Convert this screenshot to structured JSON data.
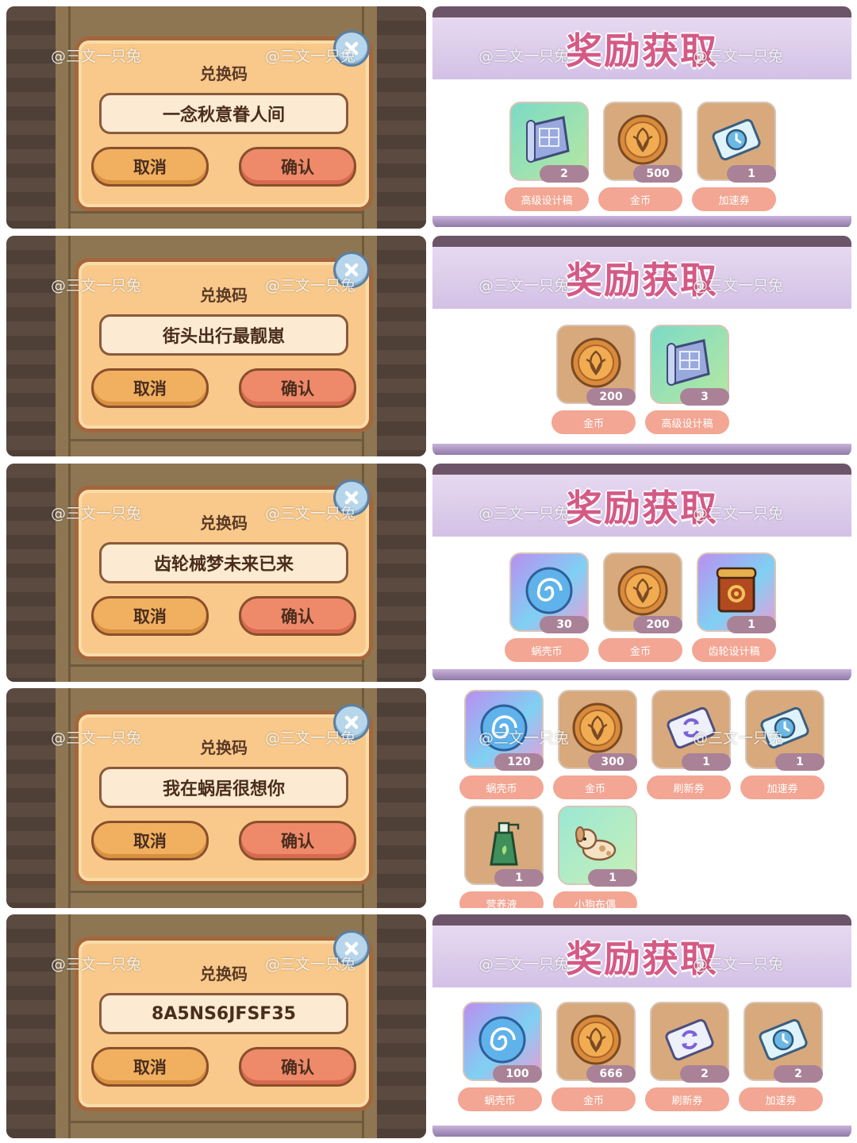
{
  "watermark": "@三文一只兔",
  "dialog": {
    "title": "兑换码",
    "cancel_label": "取消",
    "confirm_label": "确认"
  },
  "reward_header": "奖励获取",
  "codes": [
    "一念秋意眷人间",
    "街头出行最靓崽",
    "齿轮械梦未来已来",
    "我在蜗居很想你",
    "8A5NS6JFSF35"
  ],
  "rewards": [
    [
      {
        "icon": "blueprint-scroll-icon",
        "qty": "2",
        "label": "高级设计稿"
      },
      {
        "icon": "gold-coin-icon",
        "qty": "500",
        "label": "金币"
      },
      {
        "icon": "speedup-ticket-icon",
        "qty": "1",
        "label": "加速券"
      }
    ],
    [
      {
        "icon": "gold-coin-icon",
        "qty": "200",
        "label": "金币"
      },
      {
        "icon": "blueprint-scroll-icon",
        "qty": "3",
        "label": "高级设计稿"
      }
    ],
    [
      {
        "icon": "snail-shell-coin-icon",
        "qty": "30",
        "label": "蜗壳币"
      },
      {
        "icon": "gold-coin-icon",
        "qty": "200",
        "label": "金币"
      },
      {
        "icon": "gear-blueprint-icon",
        "qty": "1",
        "label": "齿轮设计稿"
      }
    ],
    [
      {
        "icon": "snail-shell-coin-icon",
        "qty": "120",
        "label": "蜗壳币"
      },
      {
        "icon": "gold-coin-icon",
        "qty": "300",
        "label": "金币"
      },
      {
        "icon": "refresh-ticket-icon",
        "qty": "1",
        "label": "刷新券"
      },
      {
        "icon": "speedup-ticket-icon",
        "qty": "1",
        "label": "加速券"
      },
      {
        "icon": "nutrient-bottle-icon",
        "qty": "1",
        "label": "营养液"
      },
      {
        "icon": "puppy-doll-icon",
        "qty": "1",
        "label": "小狗布偶"
      }
    ],
    [
      {
        "icon": "snail-shell-coin-icon",
        "qty": "100",
        "label": "蜗壳币"
      },
      {
        "icon": "gold-coin-icon",
        "qty": "666",
        "label": "金币"
      },
      {
        "icon": "refresh-ticket-icon",
        "qty": "2",
        "label": "刷新券"
      },
      {
        "icon": "speedup-ticket-icon",
        "qty": "2",
        "label": "加速券"
      }
    ]
  ]
}
